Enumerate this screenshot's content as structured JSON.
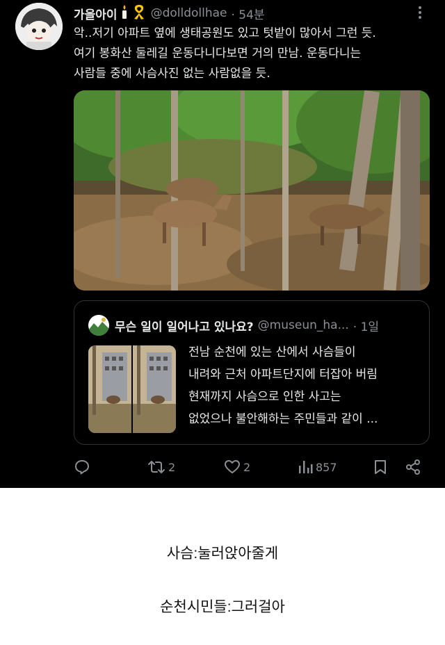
{
  "tweet": {
    "author": {
      "display_name": "가을아이",
      "handle": "@dolldollhae",
      "time": "· 54분"
    },
    "text_lines": [
      "악..저기 아파트 옆에 생태공원도 있고 텃밭이 많아서 그런 듯.",
      "여기 봉화산 둘레길 운동다니다보면 거의 만남. 운동다니는",
      "사람들 중에 사슴사진 없는 사람없을 듯."
    ],
    "image_icon": "deer-in-forest-photo",
    "quote": {
      "name": "무슨 일이 일어나고 있나요?",
      "handle": "@museun_ha...",
      "time": "· 1일",
      "thumbnail_icon": "apartment-deer-photo",
      "text_lines": [
        "전남 순천에 있는 산에서 사슴들이",
        "내려와 근처 아파트단지에 터잡아 버림",
        "현재까지 사슴으로 인한 사고는",
        "없었으나 불안해하는 주민들과 같이 ..."
      ]
    },
    "actions": {
      "reply_icon": "reply-icon",
      "retweet_count": "2",
      "like_count": "2",
      "views_count": "857",
      "bookmark_icon": "bookmark-icon",
      "share_icon": "share-icon"
    }
  },
  "captions": [
    "사슴:눌러앉아줄게",
    "순천시민들:그러걸아"
  ],
  "colors": {
    "card_bg": "#000000",
    "text": "#e7e9ea",
    "muted": "#8b9096",
    "page_bg": "#ffffff"
  }
}
